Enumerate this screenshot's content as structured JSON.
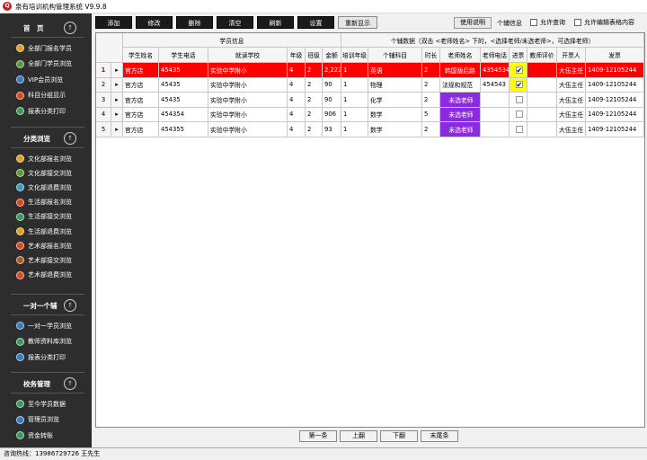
{
  "window": {
    "title": "泉有培训机构管理系统 V9.9.8",
    "icon_text": "Q"
  },
  "sidebar": {
    "sections": [
      {
        "title": "首　页",
        "items": [
          "全部门报名学员",
          "全部门学员浏览",
          "VIP会员浏览",
          "科目分组显示",
          "报表分类打印"
        ]
      },
      {
        "title": "分类浏览",
        "items": [
          "文化部报名浏览",
          "文化部接交浏览",
          "文化部退费浏览",
          "生活部报名浏览",
          "生活部接交浏览",
          "生活部退费浏览",
          "艺术部报名浏览",
          "艺术部接交浏览",
          "艺术部退费浏览"
        ]
      },
      {
        "title": "一对一个辅",
        "items": [
          "一对一学员浏览",
          "教师资料库浏览",
          "报表分类打印"
        ]
      },
      {
        "title": "校务管理",
        "items": [
          "至今学员数据",
          "管理员浏览",
          "资金转账"
        ]
      }
    ],
    "up_glyph": "↑",
    "icon_glyph": "●"
  },
  "toolbar": {
    "buttons": [
      "添加",
      "修改",
      "删除",
      "清空",
      "刷新",
      "设置"
    ],
    "refresh_display": "重新显示",
    "help": "使用说明",
    "info_label": "个辅信息",
    "allow_query": "允许查询",
    "allow_edit": "允许编辑表格内容"
  },
  "grid": {
    "group_headers": {
      "student_info": "学员信息",
      "tutor_data": "个辅数据（双击 <老师姓名> 下的，<选择老师/未选老师>，可选择老师）"
    },
    "columns": [
      "学生姓名",
      "学生电话",
      "就读学校",
      "年级",
      "班级",
      "金额",
      "培训年级",
      "个辅科目",
      "时长",
      "老师姓名",
      "老师电话",
      "进票",
      "教师评价",
      "开票人",
      "发票"
    ],
    "rows": [
      {
        "num": "1",
        "arrow": "▸",
        "name": "官方店",
        "phone": "45435",
        "school": "实验中学附小",
        "grade": "4",
        "class": "2",
        "amount": "2,222",
        "train_grade": "1",
        "subject": "英语",
        "hours": "2",
        "teacher": "韩国版后路",
        "teacher_phone": "4354534",
        "invoice_checked": "✔",
        "eval": "",
        "issuer": "大伍主任",
        "receipt": "1409-12105244"
      },
      {
        "num": "2",
        "arrow": "▸",
        "name": "官方店",
        "phone": "45435",
        "school": "实验中学附小",
        "grade": "4",
        "class": "2",
        "amount": "90",
        "train_grade": "1",
        "subject": "物理",
        "hours": "2",
        "teacher": "法规和规范",
        "teacher_phone": "454543",
        "invoice_checked": "✔",
        "eval": "",
        "issuer": "大伍主任",
        "receipt": "1409-12105244"
      },
      {
        "num": "3",
        "arrow": "▸",
        "name": "官方店",
        "phone": "45435",
        "school": "实验中学附小",
        "grade": "4",
        "class": "2",
        "amount": "90",
        "train_grade": "1",
        "subject": "化学",
        "hours": "2",
        "teacher": "未选老师",
        "teacher_phone": "",
        "invoice_checked": "",
        "eval": "",
        "issuer": "大伍主任",
        "receipt": "1409-12105244"
      },
      {
        "num": "4",
        "arrow": "▸",
        "name": "官方店",
        "phone": "454354",
        "school": "实验中学附小",
        "grade": "4",
        "class": "2",
        "amount": "906",
        "train_grade": "1",
        "subject": "数学",
        "hours": "5",
        "teacher": "未选老师",
        "teacher_phone": "",
        "invoice_checked": "",
        "eval": "",
        "issuer": "大伍主任",
        "receipt": "1409-12105244"
      },
      {
        "num": "5",
        "arrow": "▸",
        "name": "官方店",
        "phone": "454355",
        "school": "实验中学附小",
        "grade": "4",
        "class": "2",
        "amount": "93",
        "train_grade": "1",
        "subject": "数学",
        "hours": "2",
        "teacher": "未选老师",
        "teacher_phone": "",
        "invoice_checked": "",
        "eval": "",
        "issuer": "大伍主任",
        "receipt": "1409-12105244"
      }
    ]
  },
  "pager": [
    "第一条",
    "上翻",
    "下翻",
    "末尾条"
  ],
  "status": "咨询热线：13986729726 王先生",
  "colors": {
    "sidebar_bg": "#2d2d2d",
    "selected_row": "#ff0000",
    "teacher_unselected": "#8a2be2",
    "invoice_check": "#ffff00"
  }
}
